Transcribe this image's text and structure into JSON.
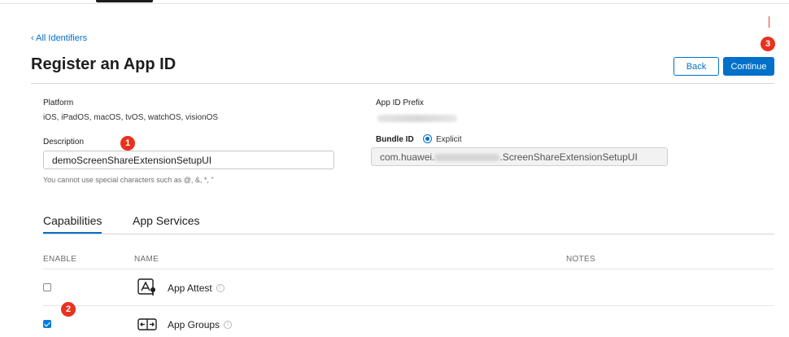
{
  "breadcrumb": {
    "label": "‹ All Identifiers"
  },
  "page": {
    "title": "Register an App ID"
  },
  "buttons": {
    "back": "Back",
    "continue": "Continue"
  },
  "annotations": [
    "1",
    "2",
    "3"
  ],
  "form": {
    "platform": {
      "label": "Platform",
      "value": "iOS, iPadOS, macOS, tvOS, watchOS, visionOS"
    },
    "description": {
      "label": "Description",
      "value": "demoScreenShareExtensionSetupUI",
      "hint": "You cannot use special characters such as @, &, *, \""
    },
    "app_id_prefix": {
      "label": "App ID Prefix"
    },
    "bundle_id": {
      "label": "Bundle ID",
      "type_option": "Explicit",
      "value_prefix": "com.huawei.",
      "value_suffix": ".ScreenShareExtensionSetupUI"
    }
  },
  "tabs": [
    {
      "label": "Capabilities",
      "active": true
    },
    {
      "label": "App Services",
      "active": false
    }
  ],
  "table": {
    "columns": [
      "ENABLE",
      "NAME",
      "NOTES"
    ],
    "rows": [
      {
        "name": "App Attest",
        "enabled": false,
        "icon": "app-attest-icon"
      },
      {
        "name": "App Groups",
        "enabled": true,
        "icon": "app-groups-icon"
      }
    ]
  },
  "colors": {
    "accent": "#0070c9",
    "badge": "#e8321e"
  }
}
